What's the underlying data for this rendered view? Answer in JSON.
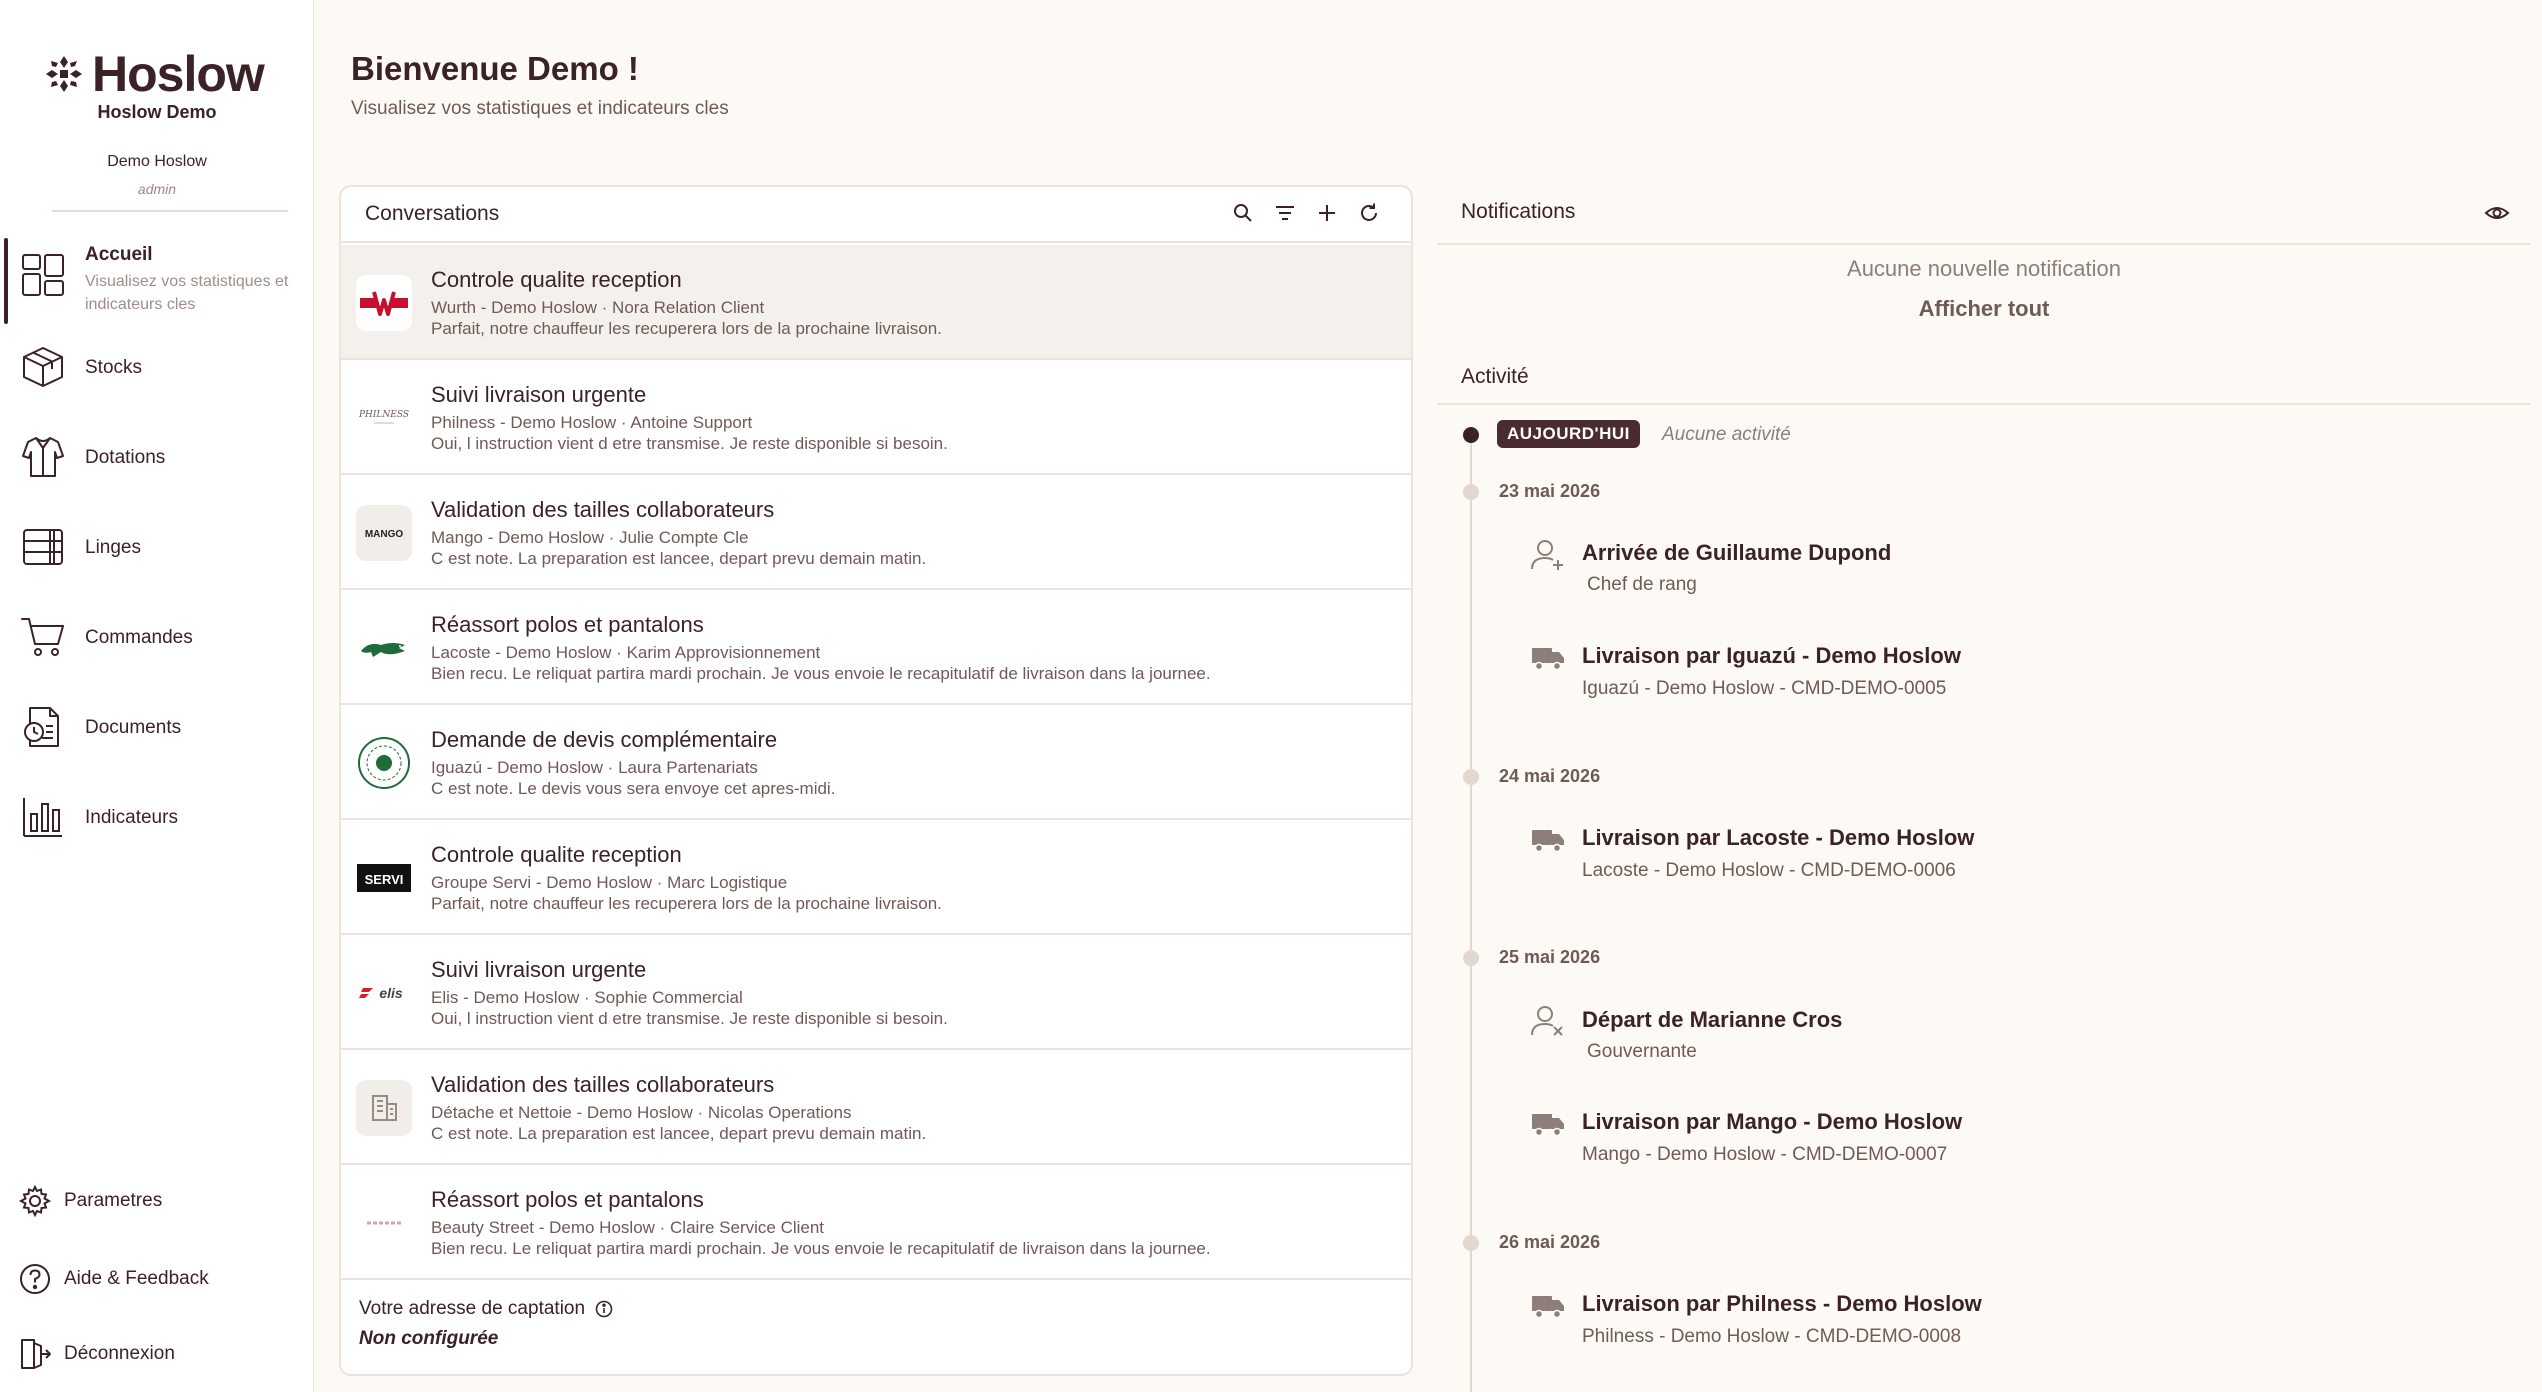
{
  "brand": {
    "logo_text": "Hoslow",
    "org_name": "Hoslow Demo",
    "user_name": "Demo Hoslow",
    "user_role": "admin"
  },
  "nav": {
    "items": [
      {
        "label": "Accueil",
        "sub": "Visualisez vos statistiques et indicateurs cles",
        "icon": "dashboard-icon"
      },
      {
        "label": "Stocks",
        "icon": "box-icon"
      },
      {
        "label": "Dotations",
        "icon": "shirt-icon"
      },
      {
        "label": "Linges",
        "icon": "linen-stack-icon"
      },
      {
        "label": "Commandes",
        "icon": "cart-icon"
      },
      {
        "label": "Documents",
        "icon": "document-icon"
      },
      {
        "label": "Indicateurs",
        "icon": "bar-chart-icon"
      }
    ],
    "bottom": [
      {
        "label": "Parametres",
        "icon": "gear-icon"
      },
      {
        "label": "Aide & Feedback",
        "icon": "help-icon"
      },
      {
        "label": "Déconnexion",
        "icon": "logout-icon"
      }
    ]
  },
  "header": {
    "title": "Bienvenue Demo !",
    "subtitle": "Visualisez vos statistiques et indicateurs cles"
  },
  "conversations": {
    "title": "Conversations",
    "items": [
      {
        "subject": "Controle qualite reception",
        "meta": "Wurth - Demo Hoslow · Nora Relation Client",
        "preview": "Parfait, notre chauffeur les recuperera lors de la prochaine livraison.",
        "logo": "wurth-logo"
      },
      {
        "subject": "Suivi livraison urgente",
        "meta": "Philness - Demo Hoslow · Antoine Support",
        "preview": "Oui, l instruction vient d etre transmise. Je reste disponible si besoin.",
        "logo": "philness-logo"
      },
      {
        "subject": "Validation des tailles collaborateurs",
        "meta": "Mango - Demo Hoslow · Julie Compte Cle",
        "preview": "C est note. La preparation est lancee, depart prevu demain matin.",
        "logo": "mango-logo"
      },
      {
        "subject": "Réassort polos et pantalons",
        "meta": "Lacoste - Demo Hoslow · Karim Approvisionnement",
        "preview": "Bien recu. Le reliquat partira mardi prochain. Je vous envoie le recapitulatif de livraison dans la journee.",
        "logo": "lacoste-logo"
      },
      {
        "subject": "Demande de devis complémentaire",
        "meta": "Iguazú - Demo Hoslow · Laura Partenariats",
        "preview": "C est note. Le devis vous sera envoye cet apres-midi.",
        "logo": "iguazu-logo"
      },
      {
        "subject": "Controle qualite reception",
        "meta": "Groupe Servi - Demo Hoslow · Marc Logistique",
        "preview": "Parfait, notre chauffeur les recuperera lors de la prochaine livraison.",
        "logo": "servi-logo"
      },
      {
        "subject": "Suivi livraison urgente",
        "meta": "Elis - Demo Hoslow · Sophie Commercial",
        "preview": "Oui, l instruction vient d etre transmise. Je reste disponible si besoin.",
        "logo": "elis-logo"
      },
      {
        "subject": "Validation des tailles collaborateurs",
        "meta": "Détache et Nettoie - Demo Hoslow · Nicolas Operations",
        "preview": "C est note. La preparation est lancee, depart prevu demain matin.",
        "logo": "building-icon"
      },
      {
        "subject": "Réassort polos et pantalons",
        "meta": "Beauty Street - Demo Hoslow · Claire Service Client",
        "preview": "Bien recu. Le reliquat partira mardi prochain. Je vous envoie le recapitulatif de livraison dans la journee.",
        "logo": "beauty-street-logo"
      }
    ],
    "capture_label": "Votre adresse de captation",
    "capture_value": "Non configurée"
  },
  "notifications": {
    "title": "Notifications",
    "empty": "Aucune nouvelle notification",
    "show_all": "Afficher tout"
  },
  "activity": {
    "title": "Activité",
    "today_badge": "AUJOURD'HUI",
    "today_empty": "Aucune activité",
    "dates": [
      "23 mai 2026",
      "24 mai 2026",
      "25 mai 2026",
      "26 mai 2026"
    ],
    "events": [
      {
        "title": "Arrivée de Guillaume Dupond",
        "sub": "Chef de rang",
        "icon": "user-add-icon"
      },
      {
        "title": "Livraison par Iguazú - Demo Hoslow",
        "sub": "Iguazú - Demo Hoslow - CMD-DEMO-0005",
        "icon": "truck-icon"
      },
      {
        "title": "Livraison par Lacoste - Demo Hoslow",
        "sub": "Lacoste - Demo Hoslow - CMD-DEMO-0006",
        "icon": "truck-icon"
      },
      {
        "title": "Départ de Marianne Cros",
        "sub": "Gouvernante",
        "icon": "user-remove-icon"
      },
      {
        "title": "Livraison par Mango - Demo Hoslow",
        "sub": "Mango - Demo Hoslow - CMD-DEMO-0007",
        "icon": "truck-icon"
      },
      {
        "title": "Livraison par Philness - Demo Hoslow",
        "sub": "Philness - Demo Hoslow - CMD-DEMO-0008",
        "icon": "truck-icon"
      }
    ]
  },
  "colors": {
    "primary": "#3b2226",
    "background": "#fdfaf5",
    "muted": "#6f5a57",
    "border": "#ece3da"
  }
}
